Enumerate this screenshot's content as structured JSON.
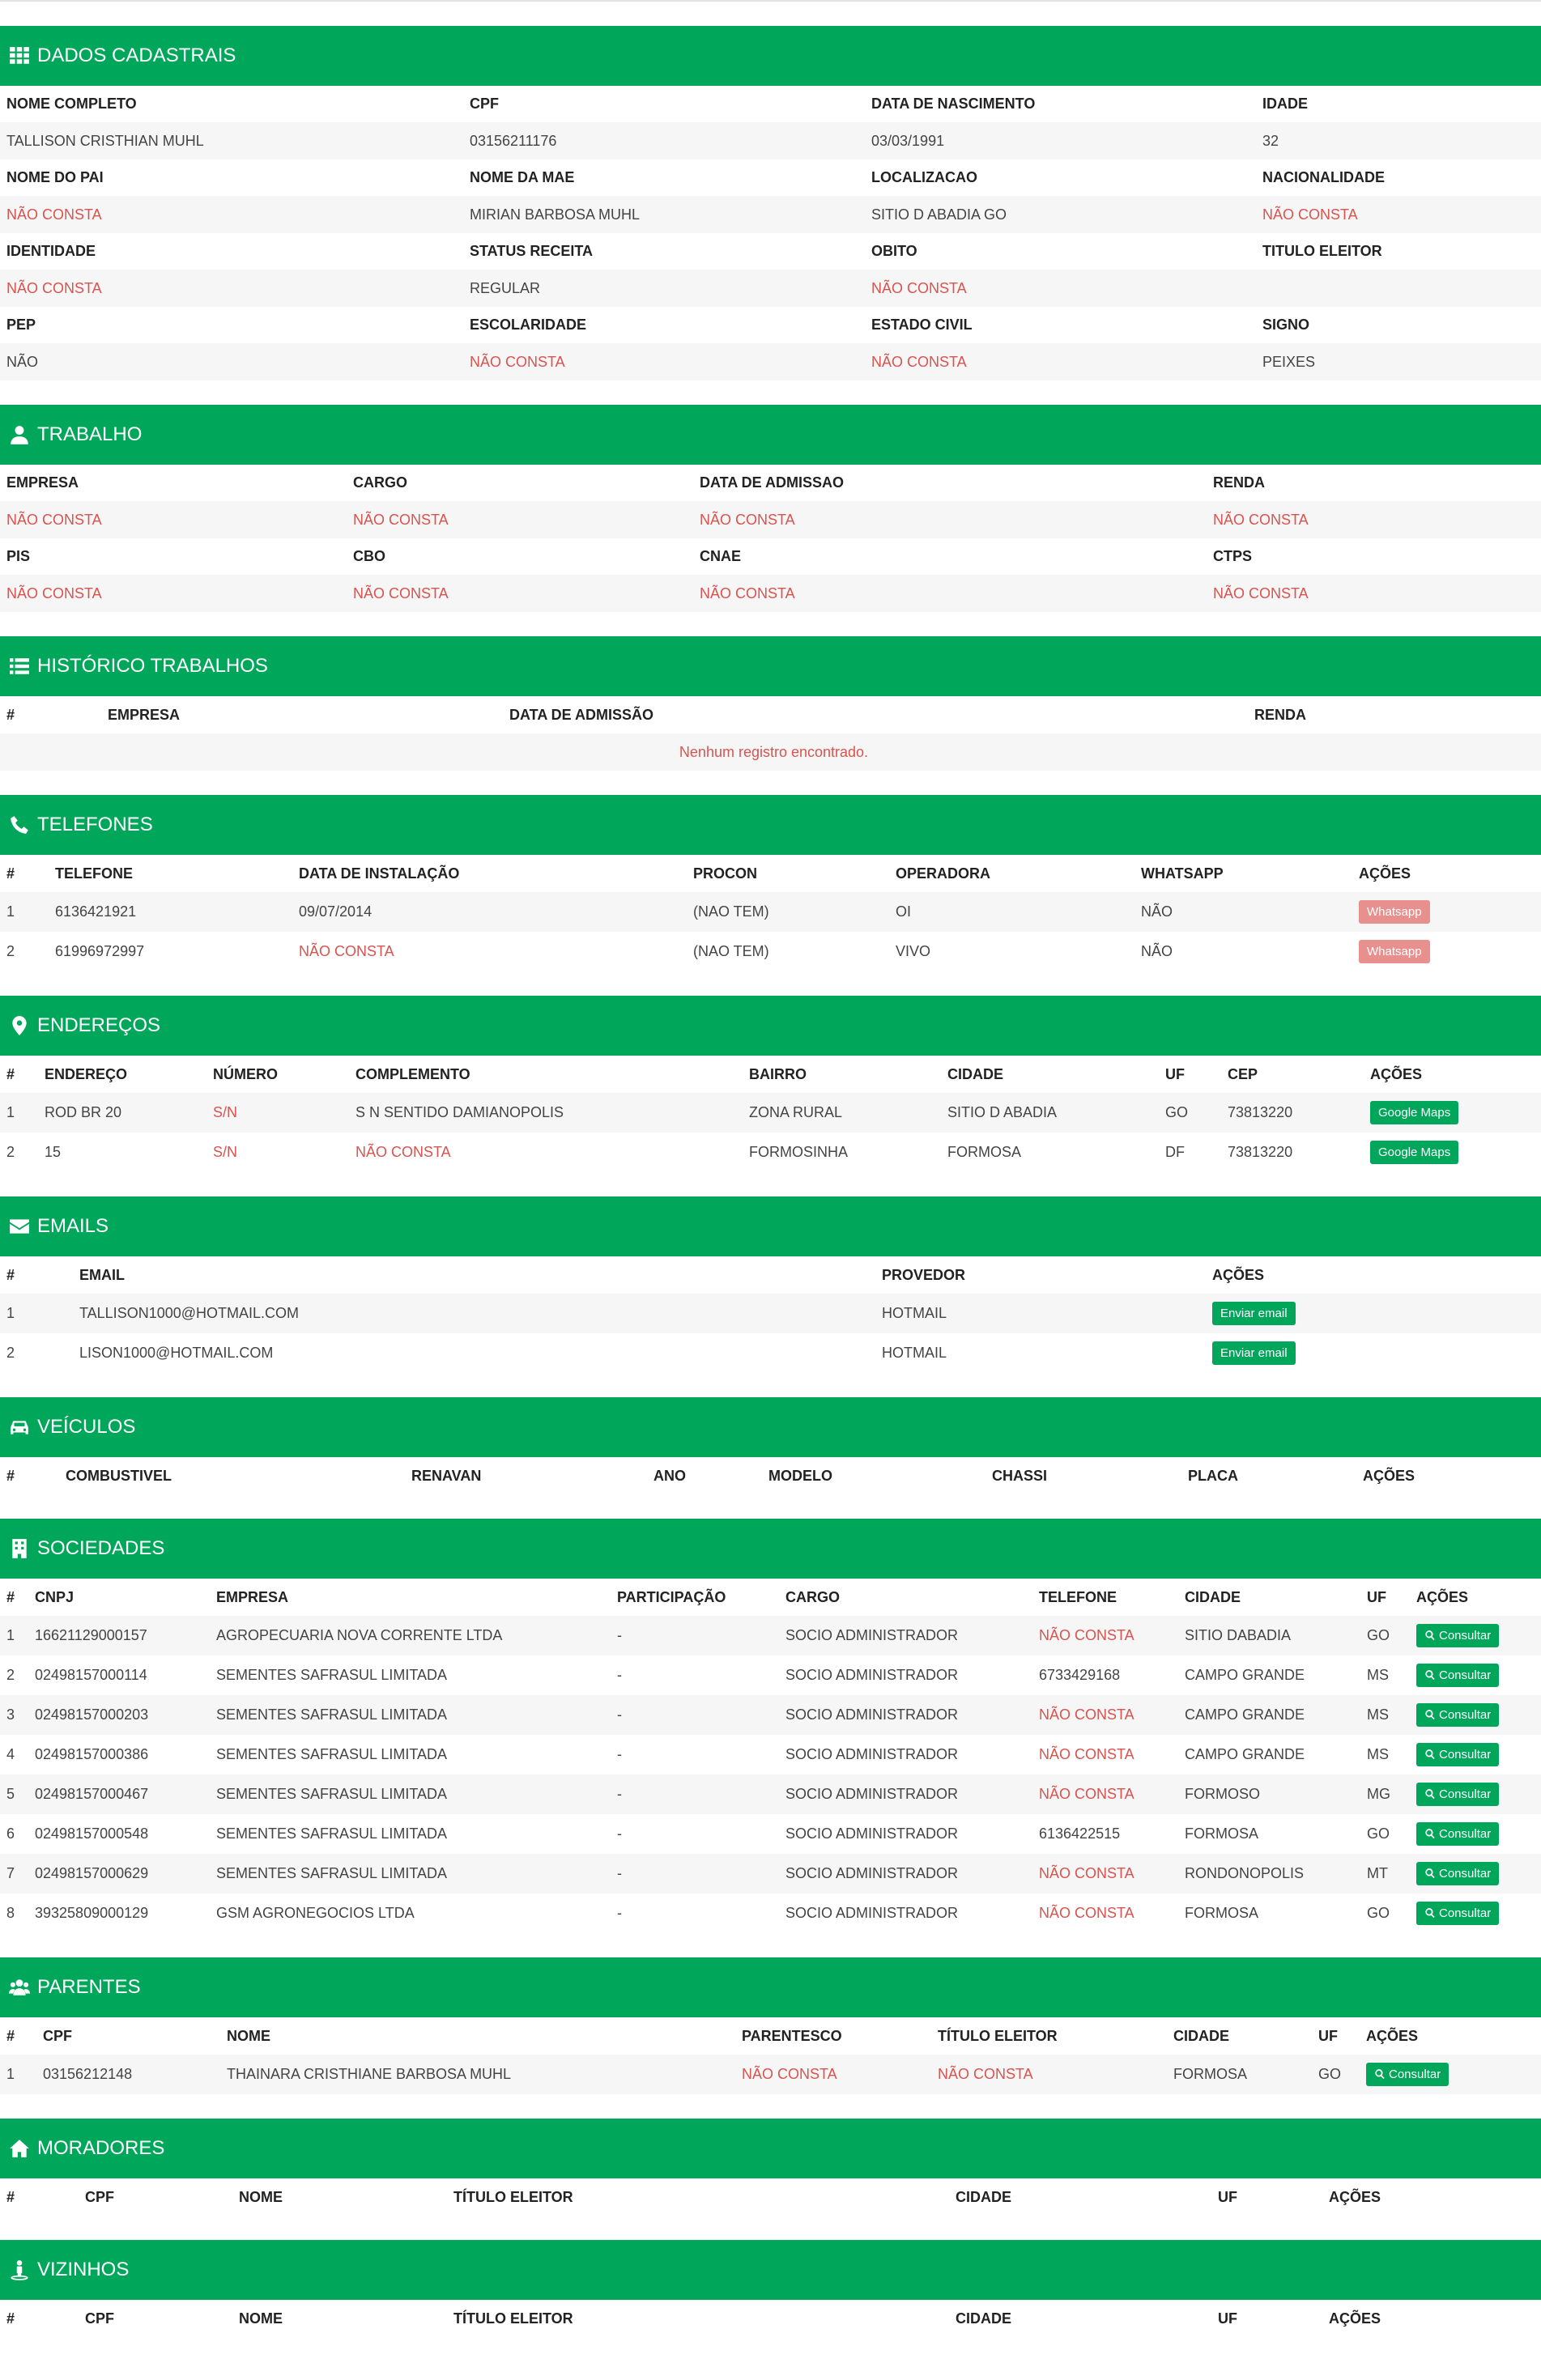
{
  "colors": {
    "header_bg": "#00a65a",
    "negative_text": "#d9534f",
    "button_green": "#00a65a",
    "button_whatsapp": "#e8908d"
  },
  "dados": {
    "title": "DADOS CADASTRAIS",
    "icon": "grid-icon",
    "rows": [
      {
        "labels": [
          "NOME COMPLETO",
          "CPF",
          "DATA DE NASCIMENTO",
          "IDADE"
        ],
        "values": [
          "TALLISON CRISTHIAN MUHL",
          "03156211176",
          "03/03/1991",
          "32"
        ]
      },
      {
        "labels": [
          "NOME DO PAI",
          "NOME DA MAE",
          "LOCALIZACAO",
          "NACIONALIDADE"
        ],
        "values": [
          "NÃO CONSTA",
          "MIRIAN BARBOSA MUHL",
          "SITIO D ABADIA GO",
          "NÃO CONSTA"
        ]
      },
      {
        "labels": [
          "IDENTIDADE",
          "STATUS RECEITA",
          "OBITO",
          "TITULO ELEITOR"
        ],
        "values": [
          "NÃO CONSTA",
          "REGULAR",
          "NÃO CONSTA",
          ""
        ]
      },
      {
        "labels": [
          "PEP",
          "ESCOLARIDADE",
          "ESTADO CIVIL",
          "SIGNO"
        ],
        "values": [
          "NÃO",
          "NÃO CONSTA",
          "NÃO CONSTA",
          "PEIXES"
        ]
      }
    ]
  },
  "trabalho": {
    "title": "TRABALHO",
    "icon": "user-tie-icon",
    "rows": [
      {
        "labels": [
          "EMPRESA",
          "CARGO",
          "DATA DE ADMISSAO",
          "RENDA"
        ],
        "values": [
          "NÃO CONSTA",
          "NÃO CONSTA",
          "NÃO CONSTA",
          "NÃO CONSTA"
        ]
      },
      {
        "labels": [
          "PIS",
          "CBO",
          "CNAE",
          "CTPS"
        ],
        "values": [
          "NÃO CONSTA",
          "NÃO CONSTA",
          "NÃO CONSTA",
          "NÃO CONSTA"
        ]
      }
    ]
  },
  "historico": {
    "title": "HISTÓRICO TRABALHOS",
    "icon": "list-icon",
    "headers": [
      "#",
      "EMPRESA",
      "DATA DE ADMISSÃO",
      "RENDA"
    ],
    "empty": "Nenhum registro encontrado."
  },
  "telefones": {
    "title": "TELEFONES",
    "icon": "phone-icon",
    "headers": [
      "#",
      "TELEFONE",
      "DATA DE INSTALAÇÃO",
      "PROCON",
      "OPERADORA",
      "WHATSAPP",
      "AÇÕES"
    ],
    "rows": [
      [
        "1",
        "6136421921",
        "09/07/2014",
        "(NAO TEM)",
        "OI",
        "NÃO"
      ],
      [
        "2",
        "61996972997",
        "NÃO CONSTA",
        "(NAO TEM)",
        "VIVO",
        "NÃO"
      ]
    ],
    "action_label": "Whatsapp"
  },
  "enderecos": {
    "title": "ENDEREÇOS",
    "icon": "map-marker-icon",
    "headers": [
      "#",
      "ENDEREÇO",
      "NÚMERO",
      "COMPLEMENTO",
      "BAIRRO",
      "CIDADE",
      "UF",
      "CEP",
      "AÇÕES"
    ],
    "rows": [
      [
        "1",
        "ROD BR 20",
        "S/N",
        "S N SENTIDO DAMIANOPOLIS",
        "ZONA RURAL",
        "SITIO D ABADIA",
        "GO",
        "73813220"
      ],
      [
        "2",
        "15",
        "S/N",
        "NÃO CONSTA",
        "FORMOSINHA",
        "FORMOSA",
        "DF",
        "73813220"
      ]
    ],
    "action_label": "Google Maps"
  },
  "emails": {
    "title": "EMAILS",
    "icon": "envelope-icon",
    "headers": [
      "#",
      "EMAIL",
      "PROVEDOR",
      "AÇÕES"
    ],
    "rows": [
      [
        "1",
        "TALLISON1000@HOTMAIL.COM",
        "HOTMAIL"
      ],
      [
        "2",
        "LISON1000@HOTMAIL.COM",
        "HOTMAIL"
      ]
    ],
    "action_label": "Enviar email"
  },
  "veiculos": {
    "title": "VEÍCULOS",
    "icon": "car-icon",
    "headers": [
      "#",
      "COMBUSTIVEL",
      "RENAVAN",
      "ANO",
      "MODELO",
      "CHASSI",
      "PLACA",
      "AÇÕES"
    ]
  },
  "sociedades": {
    "title": "SOCIEDADES",
    "icon": "building-icon",
    "headers": [
      "#",
      "CNPJ",
      "EMPRESA",
      "PARTICIPAÇÃO",
      "CARGO",
      "TELEFONE",
      "CIDADE",
      "UF",
      "AÇÕES"
    ],
    "rows": [
      [
        "1",
        "16621129000157",
        "AGROPECUARIA NOVA CORRENTE LTDA",
        "-",
        "SOCIO ADMINISTRADOR",
        "NÃO CONSTA",
        "SITIO DABADIA",
        "GO"
      ],
      [
        "2",
        "02498157000114",
        "SEMENTES SAFRASUL LIMITADA",
        "-",
        "SOCIO ADMINISTRADOR",
        "6733429168",
        "CAMPO GRANDE",
        "MS"
      ],
      [
        "3",
        "02498157000203",
        "SEMENTES SAFRASUL LIMITADA",
        "-",
        "SOCIO ADMINISTRADOR",
        "NÃO CONSTA",
        "CAMPO GRANDE",
        "MS"
      ],
      [
        "4",
        "02498157000386",
        "SEMENTES SAFRASUL LIMITADA",
        "-",
        "SOCIO ADMINISTRADOR",
        "NÃO CONSTA",
        "CAMPO GRANDE",
        "MS"
      ],
      [
        "5",
        "02498157000467",
        "SEMENTES SAFRASUL LIMITADA",
        "-",
        "SOCIO ADMINISTRADOR",
        "NÃO CONSTA",
        "FORMOSO",
        "MG"
      ],
      [
        "6",
        "02498157000548",
        "SEMENTES SAFRASUL LIMITADA",
        "-",
        "SOCIO ADMINISTRADOR",
        "6136422515",
        "FORMOSA",
        "GO"
      ],
      [
        "7",
        "02498157000629",
        "SEMENTES SAFRASUL LIMITADA",
        "-",
        "SOCIO ADMINISTRADOR",
        "NÃO CONSTA",
        "RONDONOPOLIS",
        "MT"
      ],
      [
        "8",
        "39325809000129",
        "GSM AGRONEGOCIOS LTDA",
        "-",
        "SOCIO ADMINISTRADOR",
        "NÃO CONSTA",
        "FORMOSA",
        "GO"
      ]
    ],
    "action_label": "Consultar"
  },
  "parentes": {
    "title": "PARENTES",
    "icon": "users-icon",
    "headers": [
      "#",
      "CPF",
      "NOME",
      "PARENTESCO",
      "TÍTULO ELEITOR",
      "CIDADE",
      "UF",
      "AÇÕES"
    ],
    "rows": [
      [
        "1",
        "03156212148",
        "THAINARA CRISTHIANE BARBOSA MUHL",
        "NÃO CONSTA",
        "NÃO CONSTA",
        "FORMOSA",
        "GO"
      ]
    ],
    "action_label": "Consultar"
  },
  "moradores": {
    "title": "MORADORES",
    "icon": "home-icon",
    "headers": [
      "#",
      "CPF",
      "NOME",
      "TÍTULO ELEITOR",
      "CIDADE",
      "UF",
      "AÇÕES"
    ]
  },
  "vizinhos": {
    "title": "VIZINHOS",
    "icon": "street-view-icon",
    "headers": [
      "#",
      "CPF",
      "NOME",
      "TÍTULO ELEITOR",
      "CIDADE",
      "UF",
      "AÇÕES"
    ]
  }
}
